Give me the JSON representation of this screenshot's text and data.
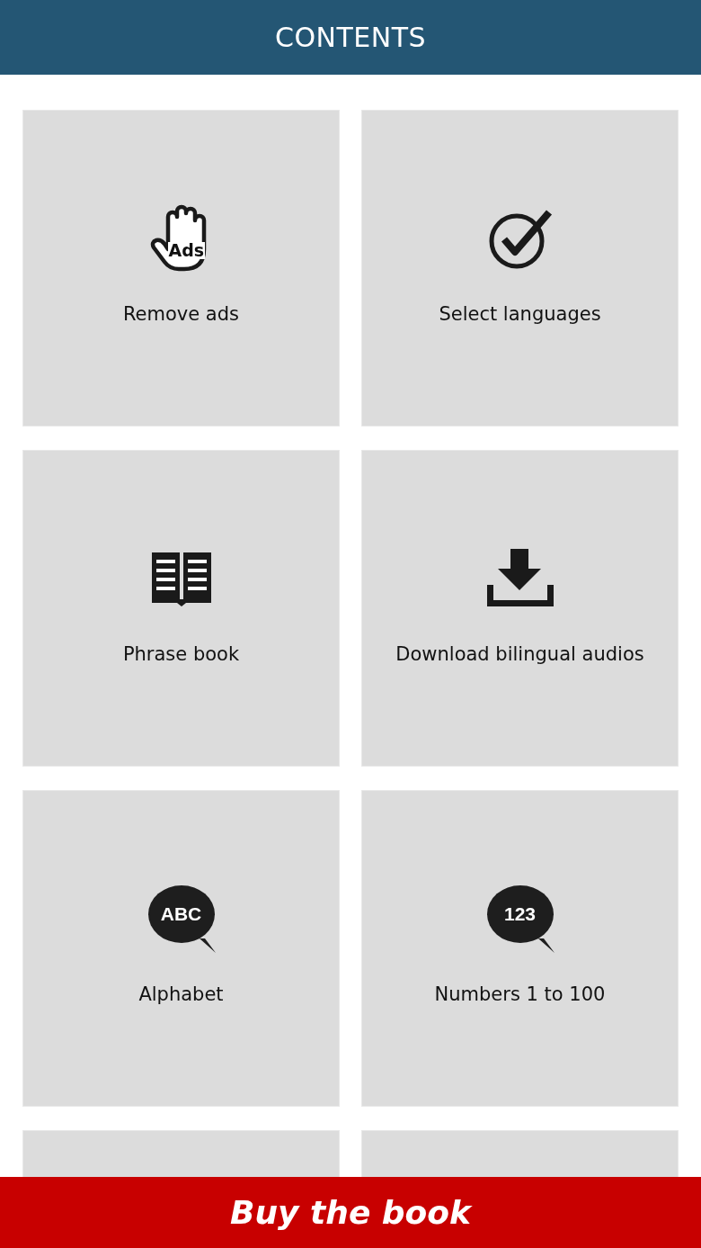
{
  "header": {
    "title": "CONTENTS"
  },
  "tiles": [
    {
      "kind": "hand",
      "icon_text": "Ads",
      "label": "Remove ads"
    },
    {
      "kind": "check",
      "label": "Select languages"
    },
    {
      "kind": "book",
      "label": "Phrase book"
    },
    {
      "kind": "download",
      "label": "Download bilingual audios"
    },
    {
      "kind": "bubble",
      "icon_text": "ABC",
      "label": "Alphabet"
    },
    {
      "kind": "bubble",
      "icon_text": "123",
      "label": "Numbers 1 to 100"
    },
    {
      "kind": "empty"
    },
    {
      "kind": "empty"
    }
  ],
  "footer": {
    "button": "Buy the book"
  }
}
